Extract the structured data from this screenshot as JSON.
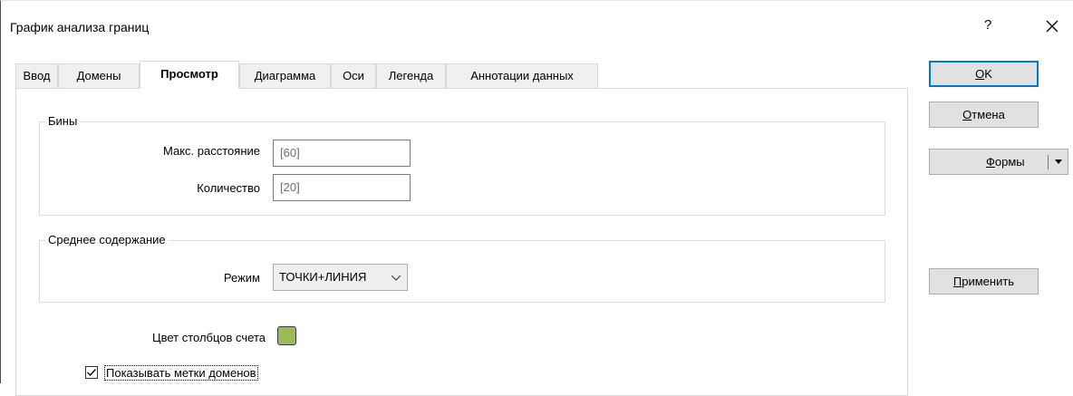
{
  "window": {
    "title": "График анализа границ",
    "help_label": "?"
  },
  "tabs": [
    {
      "label": "Ввод"
    },
    {
      "label": "Домены"
    },
    {
      "label": "Просмотр",
      "active": true
    },
    {
      "label": "Диаграмма"
    },
    {
      "label": "Оси"
    },
    {
      "label": "Легенда"
    },
    {
      "label": "Аннотации данных"
    }
  ],
  "bins": {
    "group_label": "Бины",
    "max_distance_label": "Макс. расстояние",
    "max_distance_value": "[60]",
    "count_label": "Количество",
    "count_value": "[20]"
  },
  "mean_grade": {
    "group_label": "Среднее содержание",
    "mode_label": "Режим",
    "mode_value": "ТОЧКИ+ЛИНИЯ"
  },
  "count_bar_color": {
    "label": "Цвет столбцов счета",
    "color": "#9bbb59"
  },
  "show_domain_labels": {
    "label": "Показывать метки доменов",
    "checked": true
  },
  "buttons": {
    "ok_hotkey": "O",
    "ok_rest": "K",
    "cancel_hotkey": "О",
    "cancel_rest": "тмена",
    "forms_hotkey": "Ф",
    "forms_rest": "ормы",
    "apply_hotkey": "П",
    "apply_rest": "рименить"
  },
  "icons": {
    "close": "close-icon",
    "dropdown": "chevron-down-icon",
    "check": "checkmark-icon"
  }
}
